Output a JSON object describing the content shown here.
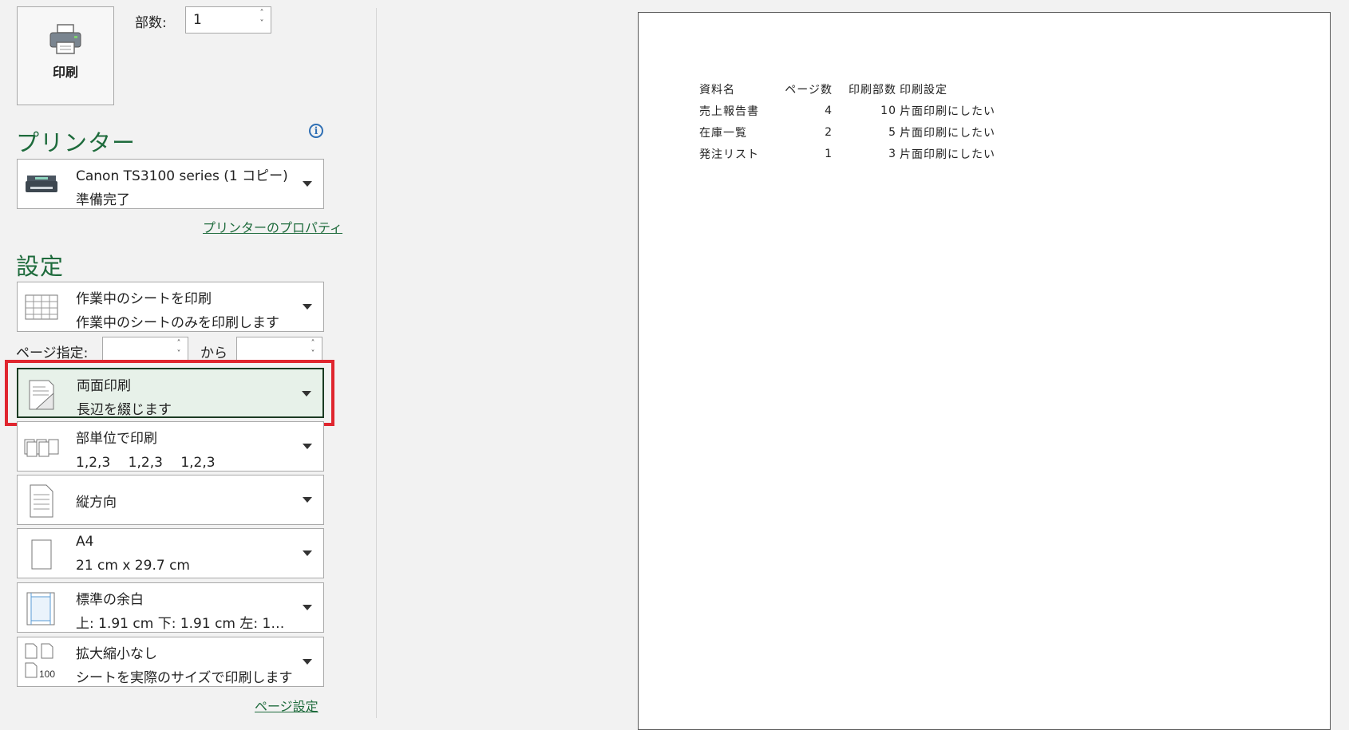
{
  "print_button": {
    "label": "印刷",
    "icon": "printer-icon"
  },
  "copies": {
    "label": "部数:",
    "value": "1"
  },
  "printer": {
    "section_title": "プリンター",
    "info_icon": "info-icon",
    "name": "Canon TS3100 series (1 コピー)",
    "status": "準備完了",
    "properties_link": "プリンターのプロパティ"
  },
  "settings": {
    "section_title": "設定",
    "print_what": {
      "title": "作業中のシートを印刷",
      "desc": "作業中のシートのみを印刷します",
      "icon": "sheet-grid-icon"
    },
    "pages": {
      "label": "ページ指定:",
      "from_value": "",
      "to_label": "から",
      "to_value": ""
    },
    "duplex": {
      "title": "両面印刷",
      "desc": "長辺を綴じます",
      "icon": "duplex-page-icon"
    },
    "collate": {
      "title": "部単位で印刷",
      "desc": "1,2,3　 1,2,3　 1,2,3",
      "icon": "collate-icon"
    },
    "orientation": {
      "title": "縦方向",
      "icon": "portrait-page-icon"
    },
    "paper": {
      "title": "A4",
      "desc": "21 cm x 29.7 cm",
      "icon": "paper-size-icon"
    },
    "margins": {
      "title": "標準の余白",
      "desc": "上: 1.91 cm 下: 1.91 cm 左: 1…",
      "icon": "margins-icon"
    },
    "scaling": {
      "title": "拡大縮小なし",
      "desc": "シートを実際のサイズで印刷します",
      "icon": "scaling-icon",
      "icon_text": "100"
    },
    "page_setup_link": "ページ設定"
  },
  "preview": {
    "headers": [
      "資料名",
      "ページ数",
      "印刷部数",
      "印刷設定"
    ],
    "rows": [
      [
        "売上報告書",
        "4",
        "10",
        "片面印刷にしたい"
      ],
      [
        "在庫一覧",
        "2",
        "5",
        "片面印刷にしたい"
      ],
      [
        "発注リスト",
        "1",
        "3",
        "片面印刷にしたい"
      ]
    ]
  },
  "colors": {
    "accent": "#1e6b3c",
    "highlight": "#e0262f",
    "selected_bg": "#e7f1e9"
  }
}
